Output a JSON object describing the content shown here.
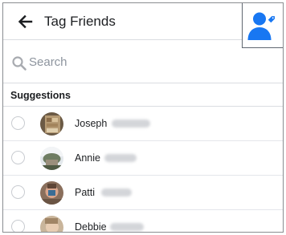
{
  "header": {
    "back_icon": "arrow-left-icon",
    "title": "Tag Friends",
    "tag_icon": "person-tag-icon",
    "tag_icon_color": "#1877f2"
  },
  "search": {
    "placeholder": "Search",
    "value": "",
    "icon": "search-icon"
  },
  "suggestions": {
    "title": "Suggestions",
    "friends": [
      {
        "first_name": "Joseph",
        "selected": false
      },
      {
        "first_name": "Annie",
        "selected": false
      },
      {
        "first_name": "Patti",
        "selected": false
      },
      {
        "first_name": "Debbie",
        "selected": false
      }
    ]
  },
  "colors": {
    "accent": "#1877f2",
    "divider": "#dadde1",
    "text": "#1c1e21",
    "muted": "#8d949e"
  }
}
